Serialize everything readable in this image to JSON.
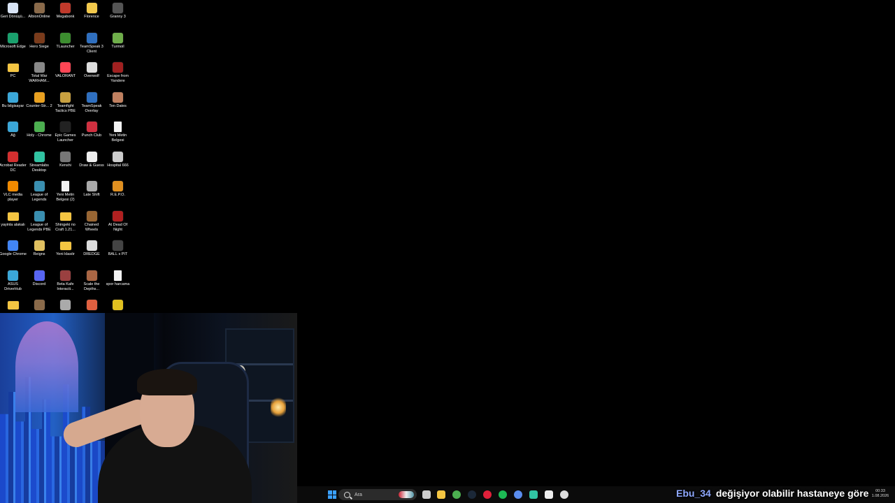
{
  "desktop": {
    "icons": [
      {
        "label": "Geri Dönüşü...",
        "icon": "recycle-bin-icon",
        "kind": "app",
        "color": "#d9e4f5",
        "col": 0,
        "row": 0
      },
      {
        "label": "AlbionOnline",
        "icon": "albion-online-icon",
        "kind": "app",
        "color": "#8a6a4a",
        "col": 1,
        "row": 0
      },
      {
        "label": "Megabonk",
        "icon": "megabonk-icon",
        "kind": "app",
        "color": "#c0392b",
        "col": 2,
        "row": 0
      },
      {
        "label": "Florence",
        "icon": "florence-icon",
        "kind": "app",
        "color": "#f2c94c",
        "col": 3,
        "row": 0
      },
      {
        "label": "Granny 3",
        "icon": "granny-3-icon",
        "kind": "app",
        "color": "#555555",
        "col": 4,
        "row": 0
      },
      {
        "label": "Microsoft Edge",
        "icon": "edge-icon",
        "kind": "app",
        "color": "#1aa06d",
        "col": 0,
        "row": 1
      },
      {
        "label": "Hero Siege",
        "icon": "hero-siege-icon",
        "kind": "app",
        "color": "#7a3b1b",
        "col": 1,
        "row": 1
      },
      {
        "label": "TLauncher",
        "icon": "tlauncher-icon",
        "kind": "app",
        "color": "#3c8d2f",
        "col": 2,
        "row": 1
      },
      {
        "label": "TeamSpeak 3 Client",
        "icon": "teamspeak-icon",
        "kind": "app",
        "color": "#2f6fbf",
        "col": 3,
        "row": 1
      },
      {
        "label": "Turmoil",
        "icon": "turmoil-icon",
        "kind": "app",
        "color": "#6fae4a",
        "col": 4,
        "row": 1
      },
      {
        "label": "PC",
        "icon": "folder-icon",
        "kind": "folder",
        "color": "#f4c542",
        "col": 0,
        "row": 2
      },
      {
        "label": "Total War WARHAM...",
        "icon": "total-war-icon",
        "kind": "app",
        "color": "#888888",
        "col": 1,
        "row": 2
      },
      {
        "label": "VALORANT",
        "icon": "valorant-icon",
        "kind": "app",
        "color": "#ff4655",
        "col": 2,
        "row": 2
      },
      {
        "label": "Overwolf",
        "icon": "overwolf-icon",
        "kind": "app",
        "color": "#dddddd",
        "col": 3,
        "row": 2
      },
      {
        "label": "Escape from Yandere",
        "icon": "escape-yandere-icon",
        "kind": "app",
        "color": "#a02020",
        "col": 4,
        "row": 2
      },
      {
        "label": "Bu bilgisayar",
        "icon": "this-pc-icon",
        "kind": "app",
        "color": "#3ba7d8",
        "col": 0,
        "row": 3
      },
      {
        "label": "Counter-Str... 2",
        "icon": "counter-strike-icon",
        "kind": "app",
        "color": "#e8a020",
        "col": 1,
        "row": 3
      },
      {
        "label": "Teamfight Tactics PBE",
        "icon": "teamfight-tactics-icon",
        "kind": "app",
        "color": "#c8a040",
        "col": 2,
        "row": 3
      },
      {
        "label": "TeamSpeak Overlay",
        "icon": "teamspeak-overlay-icon",
        "kind": "app",
        "color": "#2f6fbf",
        "col": 3,
        "row": 3
      },
      {
        "label": "Ten Dates",
        "icon": "ten-dates-icon",
        "kind": "app",
        "color": "#c08060",
        "col": 4,
        "row": 3
      },
      {
        "label": "Ağ",
        "icon": "network-icon",
        "kind": "app",
        "color": "#3ba7d8",
        "col": 0,
        "row": 4
      },
      {
        "label": "Holy - Chrome",
        "icon": "chrome-icon",
        "kind": "app",
        "color": "#4caf50",
        "col": 1,
        "row": 4
      },
      {
        "label": "Epic Games Launcher",
        "icon": "epic-games-icon",
        "kind": "app",
        "color": "#222222",
        "col": 2,
        "row": 4
      },
      {
        "label": "Punch Club",
        "icon": "punch-club-icon",
        "kind": "app",
        "color": "#d03040",
        "col": 3,
        "row": 4
      },
      {
        "label": "Yeni Metin Belgesi",
        "icon": "text-file-icon",
        "kind": "file",
        "color": "#f3f3f3",
        "col": 4,
        "row": 4
      },
      {
        "label": "Acrobat Reader DC",
        "icon": "acrobat-icon",
        "kind": "app",
        "color": "#d32f2f",
        "col": 0,
        "row": 5
      },
      {
        "label": "Streamlabs Desktop",
        "icon": "streamlabs-icon",
        "kind": "app",
        "color": "#31c3a2",
        "col": 1,
        "row": 5
      },
      {
        "label": "Kenshi",
        "icon": "kenshi-icon",
        "kind": "app",
        "color": "#777777",
        "col": 2,
        "row": 5
      },
      {
        "label": "Draw & Guess",
        "icon": "draw-guess-icon",
        "kind": "app",
        "color": "#eeeeee",
        "col": 3,
        "row": 5
      },
      {
        "label": "Hospital 666",
        "icon": "hospital-666-icon",
        "kind": "app",
        "color": "#cccccc",
        "col": 4,
        "row": 5
      },
      {
        "label": "VLC media player",
        "icon": "vlc-icon",
        "kind": "app",
        "color": "#f08a00",
        "col": 0,
        "row": 6
      },
      {
        "label": "League of Legends",
        "icon": "league-icon",
        "kind": "app",
        "color": "#3a8fb0",
        "col": 1,
        "row": 6
      },
      {
        "label": "Yeni Metin Belgesi (2)",
        "icon": "text-file-icon",
        "kind": "file",
        "color": "#f3f3f3",
        "col": 2,
        "row": 6
      },
      {
        "label": "Late Shift",
        "icon": "late-shift-icon",
        "kind": "app",
        "color": "#aaaaaa",
        "col": 3,
        "row": 6
      },
      {
        "label": "R.E.P.O.",
        "icon": "repo-icon",
        "kind": "app",
        "color": "#e09020",
        "col": 4,
        "row": 6
      },
      {
        "label": "yayinla alakalı",
        "icon": "folder-icon",
        "kind": "folder",
        "color": "#f4c542",
        "col": 0,
        "row": 7
      },
      {
        "label": "League of Legends PBE",
        "icon": "league-pbe-icon",
        "kind": "app",
        "color": "#3a8fb0",
        "col": 1,
        "row": 7
      },
      {
        "label": "Shingeki no Craft 1.21...",
        "icon": "folder-icon",
        "kind": "folder",
        "color": "#f4c542",
        "col": 2,
        "row": 7
      },
      {
        "label": "Chained Wheels",
        "icon": "chained-wheels-icon",
        "kind": "app",
        "color": "#996633",
        "col": 3,
        "row": 7
      },
      {
        "label": "At Dead Of Night",
        "icon": "at-dead-of-night-icon",
        "kind": "app",
        "color": "#b02020",
        "col": 4,
        "row": 7
      },
      {
        "label": "Google Chrome",
        "icon": "chrome-icon",
        "kind": "app",
        "color": "#4285f4",
        "col": 0,
        "row": 8
      },
      {
        "label": "Reigns",
        "icon": "reigns-icon",
        "kind": "app",
        "color": "#e0c060",
        "col": 1,
        "row": 8
      },
      {
        "label": "Yeni klasör",
        "icon": "folder-icon",
        "kind": "folder",
        "color": "#f4c542",
        "col": 2,
        "row": 8
      },
      {
        "label": "DREDGE",
        "icon": "dredge-icon",
        "kind": "app",
        "color": "#dddddd",
        "col": 3,
        "row": 8
      },
      {
        "label": "BALL x PIT",
        "icon": "ball-x-pit-icon",
        "kind": "app",
        "color": "#444444",
        "col": 4,
        "row": 8
      },
      {
        "label": "ASUS DriverHub",
        "icon": "asus-driverhub-icon",
        "kind": "app",
        "color": "#3ba7d8",
        "col": 0,
        "row": 9
      },
      {
        "label": "Discord",
        "icon": "discord-icon",
        "kind": "app",
        "color": "#5865f2",
        "col": 1,
        "row": 9
      },
      {
        "label": "Beta Kafe Interacti...",
        "icon": "beta-kafe-icon",
        "kind": "app",
        "color": "#9a4040",
        "col": 2,
        "row": 9
      },
      {
        "label": "Scale the Depths...",
        "icon": "scale-depths-icon",
        "kind": "app",
        "color": "#aa6644",
        "col": 3,
        "row": 9
      },
      {
        "label": "spor harcama",
        "icon": "text-file-icon",
        "kind": "file",
        "color": "#f3f3f3",
        "col": 4,
        "row": 9
      },
      {
        "label": "",
        "icon": "folder-icon",
        "kind": "folder",
        "color": "#f4c542",
        "col": 0,
        "row": 10
      },
      {
        "label": "",
        "icon": "game-icon",
        "kind": "app",
        "color": "#8a6a4a",
        "col": 1,
        "row": 10
      },
      {
        "label": "",
        "icon": "game-icon",
        "kind": "app",
        "color": "#aaaaaa",
        "col": 2,
        "row": 10
      },
      {
        "label": "",
        "icon": "game-icon",
        "kind": "app",
        "color": "#e06040",
        "col": 3,
        "row": 10
      },
      {
        "label": "",
        "icon": "game-icon",
        "kind": "app",
        "color": "#e0c020",
        "col": 4,
        "row": 10
      }
    ]
  },
  "taskbar": {
    "search_placeholder": "Ara",
    "apps": [
      {
        "name": "start-button",
        "icon": "windows-start-icon",
        "color": "#3aa0ff"
      },
      {
        "name": "task-view-button",
        "icon": "task-view-icon",
        "color": "#cccccc"
      },
      {
        "name": "file-explorer-button",
        "icon": "file-explorer-icon",
        "color": "#f4c542"
      },
      {
        "name": "chrome-button",
        "icon": "chrome-icon",
        "color": "#4caf50"
      },
      {
        "name": "steam-button",
        "icon": "steam-icon",
        "color": "#1b2838"
      },
      {
        "name": "opera-button",
        "icon": "opera-icon",
        "color": "#e0203a"
      },
      {
        "name": "spotify-button",
        "icon": "spotify-icon",
        "color": "#1db954"
      },
      {
        "name": "chrome-profile-button",
        "icon": "chrome-icon",
        "color": "#5a8dee"
      },
      {
        "name": "streamlabs-button",
        "icon": "streamlabs-icon",
        "color": "#31c3a2"
      },
      {
        "name": "capcut-button",
        "icon": "capcut-icon",
        "color": "#eeeeee"
      },
      {
        "name": "media-player-button",
        "icon": "play-icon",
        "color": "#dddddd"
      }
    ],
    "clock_time": "00:33",
    "clock_date": "1.08.2026"
  },
  "chat": {
    "user": "Ebu_34",
    "message": "değişiyor olabilir hastaneye göre"
  },
  "colors": {
    "desktop_bg": "#000000",
    "taskbar_bg": "#0b0b0b",
    "chat_user": "#8fa8ff"
  }
}
